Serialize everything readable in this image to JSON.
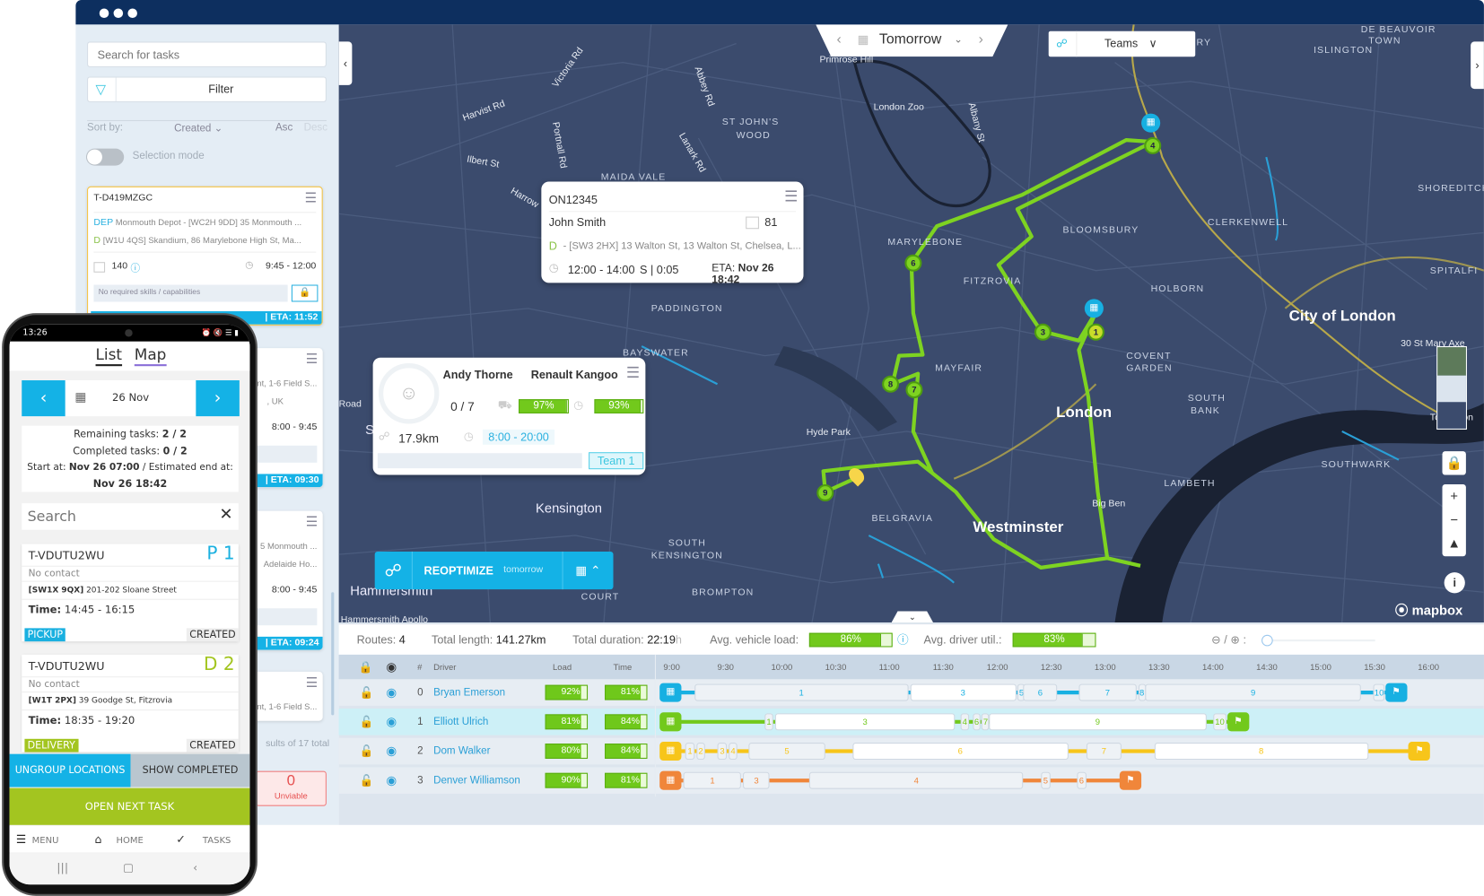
{
  "window": {
    "dots": 3
  },
  "sidebar": {
    "search_placeholder": "Search for tasks",
    "filter_label": "Filter",
    "sort_label": "Sort by:",
    "sort_value": "Created",
    "asc": "Asc",
    "desc": "Desc",
    "selection_mode": "Selection mode",
    "selection_mode_on": false,
    "cards": [
      {
        "id": "T-D419MZGC",
        "dep_tag": "DEP",
        "dep_text": "Monmouth Depot - [WC2H 9DD] 35 Monmouth ...",
        "d_tag": "D",
        "d_text": "[W1U 4QS] Skandium, 86 Marylebone High St, Ma...",
        "size": "140",
        "time": "9:45 - 12:00",
        "skills": "No required skills / capabilities",
        "eta": "| ETA: 11:52"
      },
      {
        "line1": "nt, 1-6 Field S...",
        "line2": ", UK",
        "time": "8:00 - 9:45",
        "eta": "| ETA: 09:30"
      },
      {
        "line1": "5 Monmouth ...",
        "line2": "Adelaide Ho...",
        "time": "8:00 - 9:45",
        "eta": "| ETA: 09:24"
      },
      {
        "line1": "nt, 1-6 Field S..."
      }
    ],
    "results_text": "sults of 17 total",
    "unviable_count": "0",
    "unviable_label": "Unviable"
  },
  "map": {
    "date_label": "Tomorrow",
    "teams_label": "Teams",
    "labels": [
      {
        "t": "Primrose Hill",
        "c": "sm"
      },
      {
        "t": "London Zoo",
        "c": "sm"
      },
      {
        "t": "ST JOHN'S",
        "c": ""
      },
      {
        "t": "WOOD",
        "c": ""
      },
      {
        "t": "MAIDA VALE",
        "c": ""
      },
      {
        "t": "ISLINGTON",
        "c": ""
      },
      {
        "t": "DE BEAUVOIR",
        "c": ""
      },
      {
        "t": "TOWN",
        "c": ""
      },
      {
        "t": "SHOREDITCH",
        "c": ""
      },
      {
        "t": "CLERKENWELL",
        "c": ""
      },
      {
        "t": "BLOOMSBURY",
        "c": ""
      },
      {
        "t": "MARYLEBONE",
        "c": ""
      },
      {
        "t": "FITZROVIA",
        "c": ""
      },
      {
        "t": "HOLBORN",
        "c": ""
      },
      {
        "t": "SPITALFI",
        "c": ""
      },
      {
        "t": "City of London",
        "c": "big"
      },
      {
        "t": "PADDINGTON",
        "c": ""
      },
      {
        "t": "BAYSWATER",
        "c": ""
      },
      {
        "t": "MAYFAIR",
        "c": ""
      },
      {
        "t": "COVENT",
        "c": ""
      },
      {
        "t": "GARDEN",
        "c": ""
      },
      {
        "t": "SOUTH",
        "c": ""
      },
      {
        "t": "BANK",
        "c": ""
      },
      {
        "t": "London",
        "c": "big"
      },
      {
        "t": "Hyde Park",
        "c": "sm"
      },
      {
        "t": "Kensington",
        "c": "med"
      },
      {
        "t": "BELGRAVIA",
        "c": ""
      },
      {
        "t": "Westminster",
        "c": "big"
      },
      {
        "t": "Big Ben",
        "c": "sm"
      },
      {
        "t": "LAMBETH",
        "c": ""
      },
      {
        "t": "SOUTHWARK",
        "c": ""
      },
      {
        "t": "SOUTH",
        "c": ""
      },
      {
        "t": "KENSINGTON",
        "c": ""
      },
      {
        "t": "BROMPTON",
        "c": ""
      },
      {
        "t": "COURT",
        "c": ""
      },
      {
        "t": "Hammersmith",
        "c": "med"
      },
      {
        "t": "Hammersmith Apollo",
        "c": "sm"
      },
      {
        "t": "Road",
        "c": "sm"
      },
      {
        "t": "30 St Mary Axe",
        "c": "sm"
      },
      {
        "t": "Victoria Rd",
        "c": "sm"
      },
      {
        "t": "Harvist Rd",
        "c": "sm"
      },
      {
        "t": "Ilbert St",
        "c": "sm"
      },
      {
        "t": "Harrow",
        "c": "sm"
      },
      {
        "t": "Abbey Rd",
        "c": "sm"
      },
      {
        "t": "Lanark Rd",
        "c": "sm"
      },
      {
        "t": "Portnall Rd",
        "c": "sm"
      },
      {
        "t": "Albany St",
        "c": "sm"
      },
      {
        "t": "URY",
        "c": ""
      },
      {
        "t": "Lon",
        "c": "sm"
      },
      {
        "t": "To",
        "c": "sm"
      },
      {
        "t": "S",
        "c": "med"
      }
    ],
    "route_color": "#7ed321",
    "stop_markers": [
      "4",
      "6",
      "3",
      "1",
      "8",
      "7",
      "9"
    ],
    "order_popup": {
      "id": "ON12345",
      "name": "John Smith",
      "size": "81",
      "tag": "D",
      "address": "- [SW3 2HX] 13 Walton St, 13 Walton St, Chelsea, L...",
      "window": "12:00 - 14:00",
      "service": "S | 0:05",
      "eta_label": "ETA:",
      "eta": "Nov 26 18:42"
    },
    "driver_popup": {
      "driver": "Andy Thorne",
      "vehicle": "Renault Kangoo",
      "progress": "0 / 7",
      "load": "97%",
      "load_value": 97,
      "time": "93%",
      "time_value": 93,
      "distance": "17.9km",
      "shift": "8:00 - 20:00",
      "team": "Team 1"
    },
    "reoptimize": {
      "label": "REOPTIMIZE",
      "when": "tomorrow"
    },
    "attribution": "mapbox"
  },
  "summary": {
    "routes_label": "Routes:",
    "routes": "4",
    "length_label": "Total length:",
    "length": "141.27km",
    "duration_label": "Total duration:",
    "duration": "22:19",
    "duration_unit": "h",
    "load_label": "Avg. vehicle load:",
    "load": "86%",
    "load_value": 86,
    "util_label": "Avg. driver util.:",
    "util": "83%",
    "util_value": 83,
    "zoom_label": "/"
  },
  "table": {
    "headers": {
      "num": "#",
      "driver": "Driver",
      "load": "Load",
      "time": "Time"
    },
    "ticks": [
      "9:00",
      "9:30",
      "10:00",
      "10:30",
      "11:00",
      "11:30",
      "12:00",
      "12:30",
      "13:00",
      "13:30",
      "14:00",
      "14:30",
      "15:00",
      "15:30",
      "16:00"
    ],
    "rows": [
      {
        "num": "0",
        "driver": "Bryan Emerson",
        "load": "92%",
        "load_value": 92,
        "time": "81%",
        "time_value": 81,
        "color": "#17b0e2",
        "end": "15:44",
        "stops": [
          [
            "1",
            "9:12",
            "11:11"
          ],
          [
            "3",
            "11:12",
            "12:11"
          ],
          [
            "5",
            "12:12",
            "12:14"
          ],
          [
            "6",
            "12:15",
            "12:34"
          ],
          [
            "7",
            "12:46",
            "13:18"
          ],
          [
            "8",
            "13:19",
            "13:22"
          ],
          [
            "9",
            "13:23",
            "15:23"
          ],
          [
            "10",
            "15:30",
            "15:36"
          ]
        ]
      },
      {
        "num": "1",
        "driver": "Elliott Ulrich",
        "load": "81%",
        "load_value": 81,
        "time": "84%",
        "time_value": 84,
        "color": "#72c91c",
        "end": "14:16",
        "selected": true,
        "stops": [
          [
            "1",
            "9:51",
            "9:56"
          ],
          [
            "3",
            "9:57",
            "11:37"
          ],
          [
            "4",
            "11:40",
            "11:45"
          ],
          [
            "6",
            "11:47",
            "11:51"
          ],
          [
            "7",
            "11:52",
            "11:54"
          ],
          [
            "9",
            "11:56",
            "13:57"
          ],
          [
            "10",
            "14:01",
            "14:08"
          ]
        ]
      },
      {
        "num": "2",
        "driver": "Dom Walker",
        "load": "80%",
        "load_value": 80,
        "time": "84%",
        "time_value": 84,
        "color": "#f7c51a",
        "end": "15:57",
        "stops": [
          [
            "1",
            "9:07",
            "9:12"
          ],
          [
            "2",
            "9:13",
            "9:18"
          ],
          [
            "3",
            "9:25",
            "9:30"
          ],
          [
            "4",
            "9:31",
            "9:36"
          ],
          [
            "5",
            "9:42",
            "10:25"
          ],
          [
            "6",
            "10:40",
            "12:40"
          ],
          [
            "7",
            "12:50",
            "13:10"
          ],
          [
            "8",
            "13:28",
            "15:27"
          ]
        ]
      },
      {
        "num": "3",
        "driver": "Denver Williamson",
        "load": "90%",
        "load_value": 90,
        "time": "81%",
        "time_value": 81,
        "color": "#f0863a",
        "end": "13:16",
        "stops": [
          [
            "1",
            "9:06",
            "9:38"
          ],
          [
            "3",
            "9:39",
            "9:54"
          ],
          [
            "4",
            "10:16",
            "12:15"
          ],
          [
            "5",
            "12:25",
            "12:30"
          ],
          [
            "6",
            "12:45",
            "12:50"
          ]
        ]
      }
    ]
  },
  "phone": {
    "clock": "13:26",
    "tabs": [
      "List",
      "Map"
    ],
    "date": "26 Nov",
    "remaining_label": "Remaining tasks:",
    "remaining": "2 / 2",
    "completed_label": "Completed tasks:",
    "completed": "0 / 2",
    "start_label": "Start at:",
    "start": "Nov 26 07:00",
    "end_label": "/ Estimated end at:",
    "end": "Nov 26 18:42",
    "search_placeholder": "Search",
    "tasks": [
      {
        "id": "T-VDUTU2WU",
        "badge": "P 1",
        "contact": "No contact",
        "postcode": "[SW1X 9QX]",
        "address": "201-202 Sloane Street",
        "time_label": "Time:",
        "time": "14:45 - 16:15",
        "type": "PICKUP",
        "status": "CREATED",
        "color": "#1ab0e0"
      },
      {
        "id": "T-VDUTU2WU",
        "badge": "D 2",
        "contact": "No contact",
        "postcode": "[W1T 2PX]",
        "address": "39 Goodge St, Fitzrovia",
        "time_label": "Time:",
        "time": "18:35 - 19:20",
        "type": "DELIVERY",
        "status": "CREATED",
        "color": "#a3c520"
      }
    ],
    "ungroup": "UNGROUP LOCATIONS",
    "show_completed": "SHOW COMPLETED",
    "open_next": "OPEN NEXT TASK",
    "nav": {
      "menu": "MENU",
      "home": "HOME",
      "tasks": "TASKS"
    }
  }
}
